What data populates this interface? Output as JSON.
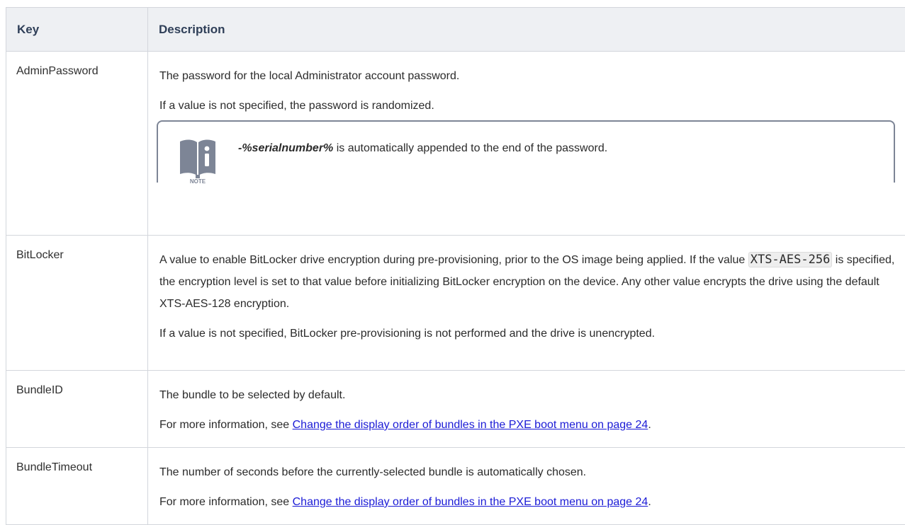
{
  "table": {
    "headers": {
      "key": "Key",
      "description": "Description"
    },
    "rows": [
      {
        "key": "AdminPassword",
        "lines": [
          "The password for the local Administrator account password.",
          "If a value is not specified, the password is randomized."
        ],
        "note": {
          "label": "NOTE",
          "emphasis": "-%serialnumber%",
          "text": " is automatically appended to the end of the password."
        }
      },
      {
        "key": "BitLocker",
        "p1_before": "A value to enable BitLocker drive encryption during pre-provisioning, prior to the OS image being applied. If the value ",
        "code": "XTS-AES-256",
        "p1_after": " is specified, the encryption level is set to that value before initializing BitLocker encryption on the device. Any other value encrypts the drive using the default XTS-AES-128 encryption.",
        "p2": "If a value is not specified, BitLocker pre-provisioning is not performed and the drive is unencrypted."
      },
      {
        "key": "BundleID",
        "line1": "The bundle to be selected by default.",
        "more_prefix": "For more information, see ",
        "link": "Change the display order of bundles in the PXE boot menu on page 24",
        "more_suffix": "."
      },
      {
        "key": "BundleTimeout",
        "line1": "The number of seconds before the currently-selected bundle is automatically chosen.",
        "more_prefix": "For more information, see ",
        "link": "Change the display order of bundles in the PXE boot menu on page 24",
        "more_suffix": "."
      }
    ]
  },
  "colors": {
    "header_bg": "#eef0f3",
    "header_text": "#2f3f58",
    "border": "#d3d6dc",
    "link": "#1b1bd6",
    "note_icon": "#7d8596"
  }
}
